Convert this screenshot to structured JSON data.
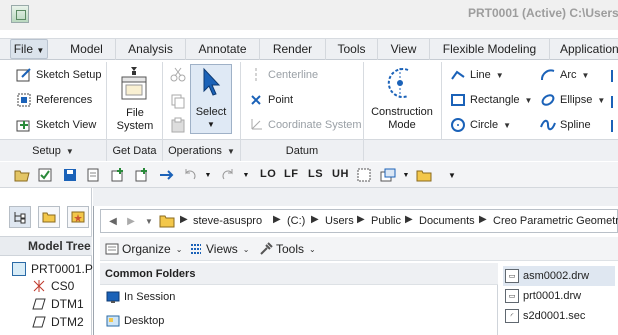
{
  "window": {
    "title": "PRT0001 (Active) C:\\Users"
  },
  "menu_tabs": [
    "File",
    "Model",
    "Analysis",
    "Annotate",
    "Render",
    "Tools",
    "View",
    "Flexible Modeling",
    "Application"
  ],
  "ribbon": {
    "setup": {
      "sketch_setup": "Sketch Setup",
      "references": "References",
      "sketch_view": "Sketch View",
      "footer": "Setup"
    },
    "get_data": {
      "file_system_line1": "File",
      "file_system_line2": "System",
      "footer": "Get Data"
    },
    "operations": {
      "select": "Select",
      "footer": "Operations"
    },
    "datum": {
      "centerline": "Centerline",
      "point": "Point",
      "coordinate_system": "Coordinate System",
      "footer": "Datum"
    },
    "construction": {
      "line1": "Construction",
      "line2": "Mode"
    },
    "sketching": {
      "line": "Line",
      "rectangle": "Rectangle",
      "circle": "Circle",
      "arc": "Arc",
      "ellipse": "Ellipse",
      "spline": "Spline"
    }
  },
  "quickbar": {
    "text_buttons": [
      "LO",
      "LF",
      "LS",
      "UH"
    ]
  },
  "model_tree": {
    "header": "Model Tree",
    "items": [
      "PRT0001.P",
      "CS0",
      "DTM1",
      "DTM2"
    ]
  },
  "file_dialog": {
    "breadcrumbs": [
      "steve-asuspro",
      "(C:)",
      "Users",
      "Public",
      "Documents",
      "Creo Parametric Geometry"
    ],
    "toolbar": {
      "organize": "Organize",
      "views": "Views",
      "tools": "Tools"
    },
    "common_folders": {
      "header": "Common Folders",
      "items": [
        "In Session",
        "Desktop"
      ]
    },
    "files": [
      "asm0002.drw",
      "prt0001.drw",
      "s2d0001.sec"
    ]
  },
  "colors": {
    "accent_blue": "#1b62b8",
    "disabled_gray": "#9aa0a6",
    "panel_bg": "#eef0f3",
    "folder_yellow": "#f3c74a"
  }
}
